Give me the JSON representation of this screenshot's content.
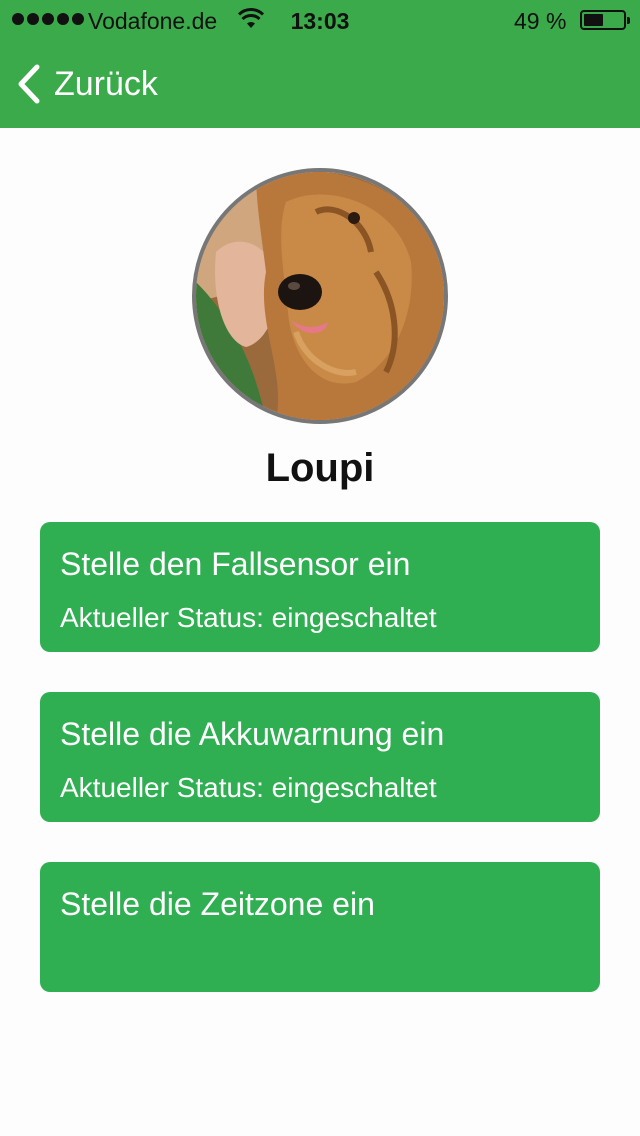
{
  "status_bar": {
    "carrier": "Vodafone.de",
    "time": "13:03",
    "battery_percent": "49 %",
    "battery_level": 0.49,
    "icons": [
      "signal-dots-icon",
      "wifi-icon",
      "battery-icon"
    ]
  },
  "nav": {
    "back_label": "Zurück",
    "back_icon": "chevron-left-icon",
    "bar_color": "#3aaa4a"
  },
  "profile": {
    "name": "Loupi",
    "avatar": "dog-photo"
  },
  "settings": [
    {
      "title": "Stelle den Fallsensor ein",
      "status": "Aktueller Status: eingeschaltet"
    },
    {
      "title": "Stelle die Akkuwarnung ein",
      "status": "Aktueller Status: eingeschaltet"
    },
    {
      "title": "Stelle die Zeitzone ein",
      "status": ""
    }
  ],
  "colors": {
    "card": "#2fae52",
    "background": "#fdfdfd"
  }
}
